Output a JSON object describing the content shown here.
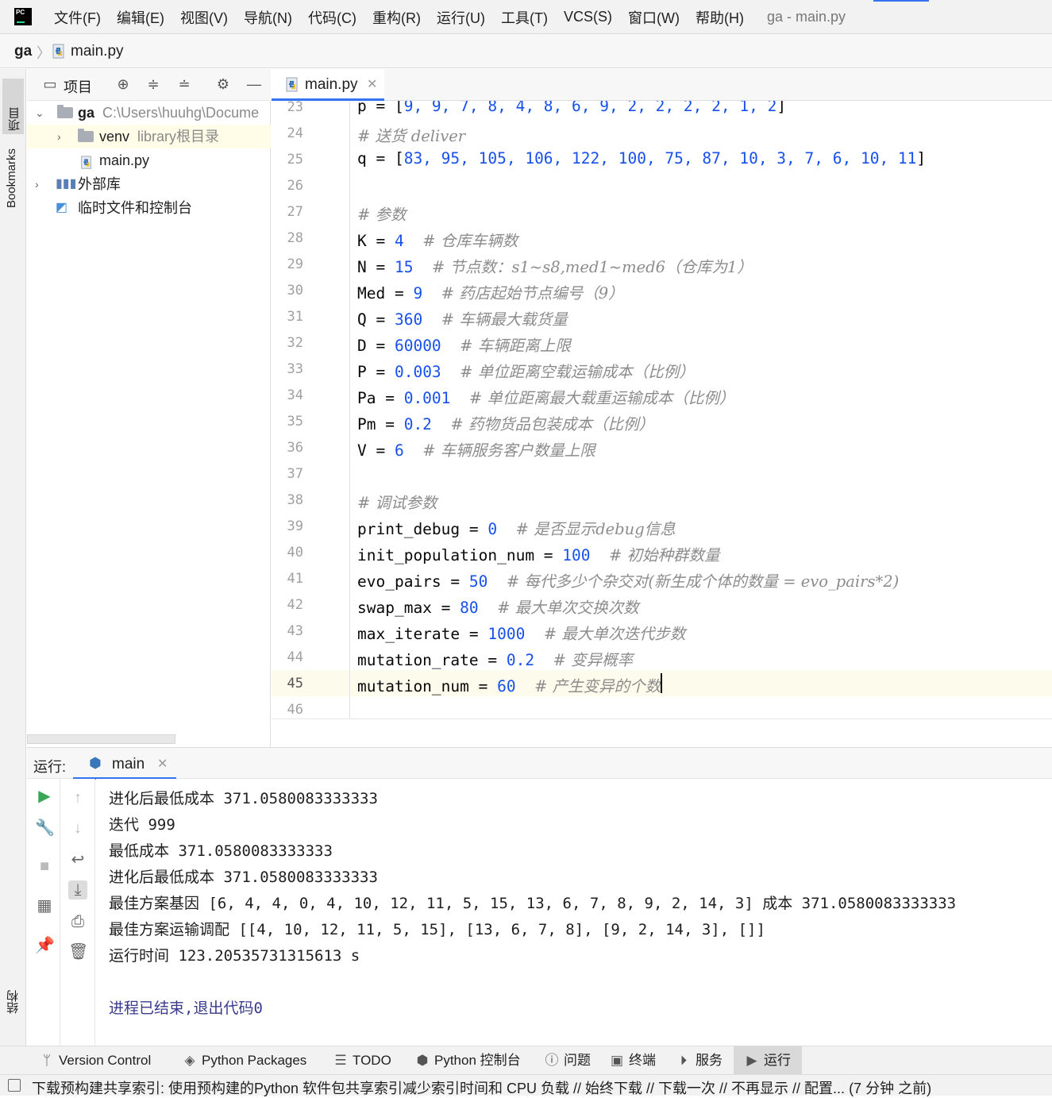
{
  "menubar": {
    "logo_text": "PC",
    "items": [
      "文件(F)",
      "编辑(E)",
      "视图(V)",
      "导航(N)",
      "代码(C)",
      "重构(R)",
      "运行(U)",
      "工具(T)",
      "VCS(S)",
      "窗口(W)",
      "帮助(H)"
    ],
    "window_title": "ga - main.py"
  },
  "breadcrumb": {
    "project": "ga",
    "separator": "〉",
    "file": "main.py"
  },
  "left_strip": {
    "project_tab": "项目",
    "bookmarks_tab": "Bookmarks",
    "structure_tab": "结构"
  },
  "project_panel": {
    "title": "项目",
    "tree": {
      "root_name": "ga",
      "root_path": "C:\\Users\\huuhg\\Docume",
      "venv_name": "venv",
      "venv_hint": "library根目录",
      "main_file": "main.py",
      "external_libs": "外部库",
      "scratches": "临时文件和控制台"
    }
  },
  "editor": {
    "tab_label": "main.py",
    "line_numbers": [
      "23",
      "24",
      "25",
      "26",
      "27",
      "28",
      "29",
      "30",
      "31",
      "32",
      "33",
      "34",
      "35",
      "36",
      "37",
      "38",
      "39",
      "40",
      "41",
      "42",
      "43",
      "44",
      "45",
      "46"
    ],
    "current_line": "45",
    "lines": [
      {
        "code": "p = [",
        "nums": "9, 9, 7, 8, 4, 8, 6, 9, 2, 2, 2, 2, 1, 2",
        "tail": "]",
        "comment": ""
      },
      {
        "code": "",
        "nums": "",
        "tail": "",
        "comment": "# 送货 deliver"
      },
      {
        "code": "q = [",
        "nums": "83, 95, 105, 106, 122, 100, 75, 87, 10, 3, 7, 6, 10, 11",
        "tail": "]",
        "comment": ""
      },
      {
        "code": "",
        "nums": "",
        "tail": "",
        "comment": ""
      },
      {
        "code": "",
        "nums": "",
        "tail": "",
        "comment": "# 参数"
      },
      {
        "code": "K = ",
        "nums": "4",
        "tail": "  ",
        "comment": "# 仓库车辆数"
      },
      {
        "code": "N = ",
        "nums": "15",
        "tail": "  ",
        "comment": "# 节点数：s1~s8,med1~med6（仓库为1）"
      },
      {
        "code": "Med = ",
        "nums": "9",
        "tail": "  ",
        "comment": "# 药店起始节点编号（9）"
      },
      {
        "code": "Q = ",
        "nums": "360",
        "tail": "  ",
        "comment": "# 车辆最大载货量"
      },
      {
        "code": "D = ",
        "nums": "60000",
        "tail": "  ",
        "comment": "# 车辆距离上限"
      },
      {
        "code": "P = ",
        "nums": "0.003",
        "tail": "  ",
        "comment": "# 单位距离空载运输成本（比例）"
      },
      {
        "code": "Pa = ",
        "nums": "0.001",
        "tail": "  ",
        "comment": "# 单位距离最大载重运输成本（比例）"
      },
      {
        "code": "Pm = ",
        "nums": "0.2",
        "tail": "  ",
        "comment": "# 药物货品包装成本（比例）"
      },
      {
        "code": "V = ",
        "nums": "6",
        "tail": "  ",
        "comment": "# 车辆服务客户数量上限"
      },
      {
        "code": "",
        "nums": "",
        "tail": "",
        "comment": ""
      },
      {
        "code": "",
        "nums": "",
        "tail": "",
        "comment": "# 调试参数"
      },
      {
        "code": "print_debug = ",
        "nums": "0",
        "tail": "  ",
        "comment": "# 是否显示debug信息"
      },
      {
        "code": "init_population_num = ",
        "nums": "100",
        "tail": "  ",
        "comment": "# 初始种群数量"
      },
      {
        "code": "evo_pairs = ",
        "nums": "50",
        "tail": "  ",
        "comment": "# 每代多少个杂交对(新生成个体的数量 = evo_pairs*2)"
      },
      {
        "code": "swap_max = ",
        "nums": "80",
        "tail": "  ",
        "comment": "# 最大单次交换次数"
      },
      {
        "code": "max_iterate = ",
        "nums": "1000",
        "tail": "  ",
        "comment": "# 最大单次迭代步数"
      },
      {
        "code": "mutation_rate = ",
        "nums": "0.2",
        "tail": "  ",
        "comment": "# 变异概率"
      },
      {
        "code": "mutation_num = ",
        "nums": "60",
        "tail": "  ",
        "comment": "# 产生变异的个数"
      },
      {
        "code": "",
        "nums": "",
        "tail": "",
        "comment": ""
      }
    ]
  },
  "run_panel": {
    "label": "运行:",
    "tab_label": "main",
    "output": [
      "进化后最低成本 371.0580083333333",
      "迭代 999",
      "最低成本 371.0580083333333",
      "进化后最低成本 371.0580083333333",
      "最佳方案基因 [6, 4, 4, 0, 4, 10, 12, 11, 5, 15, 13, 6, 7, 8, 9, 2, 14, 3] 成本 371.0580083333333",
      "最佳方案运输调配 [[4, 10, 12, 11, 5, 15], [13, 6, 7, 8], [9, 2, 14, 3], []]",
      "运行时间 123.20535731315613 s",
      "",
      "进程已结束,退出代码0"
    ]
  },
  "bottom_tools": [
    "Version Control",
    "Python Packages",
    "TODO",
    "Python 控制台",
    "问题",
    "终端",
    "服务",
    "运行"
  ],
  "statusbar": {
    "text": "下载预构建共享索引: 使用预构建的Python 软件包共享索引减少索引时间和 CPU 负载 // 始终下载 // 下载一次 // 不再显示 // 配置... (7 分钟 之前)"
  },
  "colors": {
    "accent": "#3574f0",
    "number": "#1750eb",
    "comment": "#8c8c8c",
    "current_line": "#fdfbec"
  }
}
